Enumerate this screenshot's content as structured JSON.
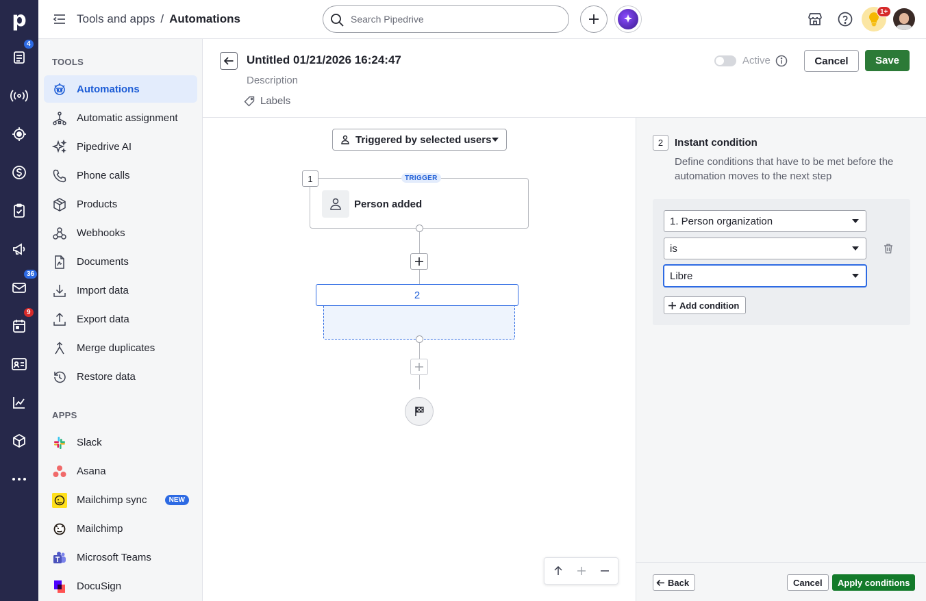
{
  "rail": {
    "logo": "p",
    "badges": {
      "leads": "4",
      "mail": "36",
      "activities": "9"
    }
  },
  "topbar": {
    "breadcrumb_parent": "Tools and apps",
    "breadcrumb_sep": "/",
    "breadcrumb_current": "Automations",
    "search_placeholder": "Search Pipedrive",
    "tips_badge": "1+"
  },
  "sidebar": {
    "tools_title": "TOOLS",
    "tools": [
      {
        "label": "Automations",
        "icon": "robot-icon"
      },
      {
        "label": "Automatic assignment",
        "icon": "assignment-icon"
      },
      {
        "label": "Pipedrive AI",
        "icon": "sparkle-icon"
      },
      {
        "label": "Phone calls",
        "icon": "phone-icon"
      },
      {
        "label": "Products",
        "icon": "box-icon"
      },
      {
        "label": "Webhooks",
        "icon": "webhook-icon"
      },
      {
        "label": "Documents",
        "icon": "document-icon"
      },
      {
        "label": "Import data",
        "icon": "import-icon"
      },
      {
        "label": "Export data",
        "icon": "export-icon"
      },
      {
        "label": "Merge duplicates",
        "icon": "merge-icon"
      },
      {
        "label": "Restore data",
        "icon": "restore-icon"
      }
    ],
    "apps_title": "APPS",
    "apps": [
      {
        "label": "Slack",
        "icon": "slack-icon"
      },
      {
        "label": "Asana",
        "icon": "asana-icon"
      },
      {
        "label": "Mailchimp sync",
        "icon": "mailchimp-icon",
        "badge": "NEW"
      },
      {
        "label": "Mailchimp",
        "icon": "mailchimp-icon"
      },
      {
        "label": "Microsoft Teams",
        "icon": "teams-icon"
      },
      {
        "label": "DocuSign",
        "icon": "docusign-icon"
      }
    ]
  },
  "automation": {
    "title": "Untitled 01/21/2026 16:24:47",
    "description_placeholder": "Description",
    "labels": "Labels",
    "active_label": "Active",
    "cancel": "Cancel",
    "save": "Save"
  },
  "canvas": {
    "trigger_dropdown": "Triggered by selected users",
    "step1_number": "1",
    "trigger_tag": "TRIGGER",
    "trigger_label": "Person added",
    "step2_number": "2"
  },
  "panel": {
    "step_number": "2",
    "title": "Instant condition",
    "description": "Define conditions that have to be met before the automation moves to the next step",
    "field": "1. Person organization",
    "operator": "is",
    "value": "Libre",
    "add_condition": "Add condition",
    "back": "Back",
    "cancel": "Cancel",
    "apply": "Apply conditions"
  },
  "colors": {
    "rail_bg": "#26284a",
    "accent_blue": "#2d6ae3",
    "save_green": "#2c7a37",
    "apply_green": "#137a2a",
    "badge_red": "#d62a2a"
  }
}
